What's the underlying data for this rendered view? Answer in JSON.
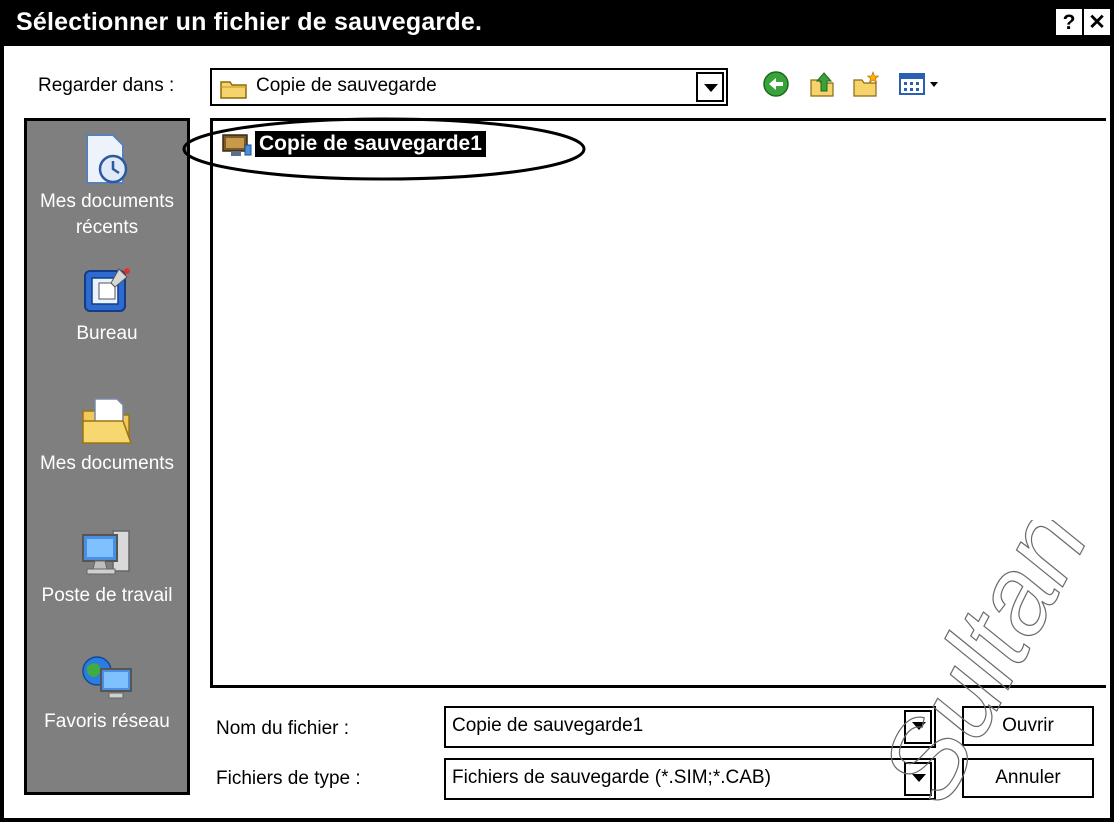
{
  "dialog": {
    "title": "Sélectionner un fichier de sauvegarde.",
    "help_label": "?",
    "close_label": "✕"
  },
  "lookin": {
    "label": "Regarder dans :",
    "value": "Copie de sauvegarde"
  },
  "toolbar": {
    "icons": [
      "back-icon",
      "up-folder-icon",
      "new-folder-icon",
      "view-menu-icon"
    ]
  },
  "sidebar": {
    "items": [
      {
        "label_line1": "Mes documents",
        "label_line2": "récents",
        "icon": "recent-documents-icon"
      },
      {
        "label_line1": "Bureau",
        "label_line2": "",
        "icon": "desktop-icon"
      },
      {
        "label_line1": "Mes documents",
        "label_line2": "",
        "icon": "my-documents-icon"
      },
      {
        "label_line1": "Poste de travail",
        "label_line2": "",
        "icon": "my-computer-icon"
      },
      {
        "label_line1": "Favoris réseau",
        "label_line2": "",
        "icon": "network-places-icon"
      }
    ]
  },
  "files": [
    {
      "name": "Copie de sauvegarde1",
      "selected": true
    }
  ],
  "filename": {
    "label": "Nom du fichier :",
    "value": "Copie de sauvegarde1"
  },
  "filetype": {
    "label": "Fichiers de type :",
    "value": "Fichiers de sauvegarde (*.SIM;*.CAB)"
  },
  "buttons": {
    "open": "Ouvrir",
    "cancel": "Annuler"
  },
  "watermark": {
    "text": "Sultan"
  },
  "colors": {
    "sidebar_bg": "#7f7f7f",
    "title_bg": "#000000",
    "selection_bg": "#000000"
  }
}
